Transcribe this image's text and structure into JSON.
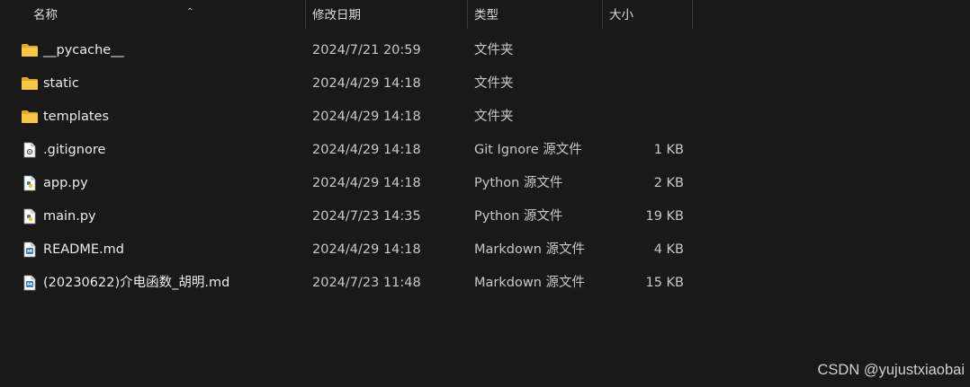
{
  "columns": {
    "name": "名称",
    "date": "修改日期",
    "type": "类型",
    "size": "大小"
  },
  "files": [
    {
      "name": "__pycache__",
      "date": "2024/7/21 20:59",
      "type": "文件夹",
      "size": "",
      "icon": "folder-icon"
    },
    {
      "name": "static",
      "date": "2024/4/29 14:18",
      "type": "文件夹",
      "size": "",
      "icon": "folder-icon"
    },
    {
      "name": "templates",
      "date": "2024/4/29 14:18",
      "type": "文件夹",
      "size": "",
      "icon": "folder-icon"
    },
    {
      "name": ".gitignore",
      "date": "2024/4/29 14:18",
      "type": "Git Ignore 源文件",
      "size": "1 KB",
      "icon": "gitignore-file-icon"
    },
    {
      "name": "app.py",
      "date": "2024/4/29 14:18",
      "type": "Python 源文件",
      "size": "2 KB",
      "icon": "python-file-icon"
    },
    {
      "name": "main.py",
      "date": "2024/7/23 14:35",
      "type": "Python 源文件",
      "size": "19 KB",
      "icon": "python-file-icon"
    },
    {
      "name": "README.md",
      "date": "2024/4/29 14:18",
      "type": "Markdown 源文件",
      "size": "4 KB",
      "icon": "markdown-file-icon"
    },
    {
      "name": "(20230622)介电函数_胡明.md",
      "date": "2024/7/23 11:48",
      "type": "Markdown 源文件",
      "size": "15 KB",
      "icon": "markdown-file-icon"
    }
  ],
  "watermark": "CSDN @yujustxiaobai",
  "colors": {
    "background": "#191919",
    "folder": "#f4c043",
    "python": "#4a88c7",
    "markdown": "#3d7fc0"
  }
}
